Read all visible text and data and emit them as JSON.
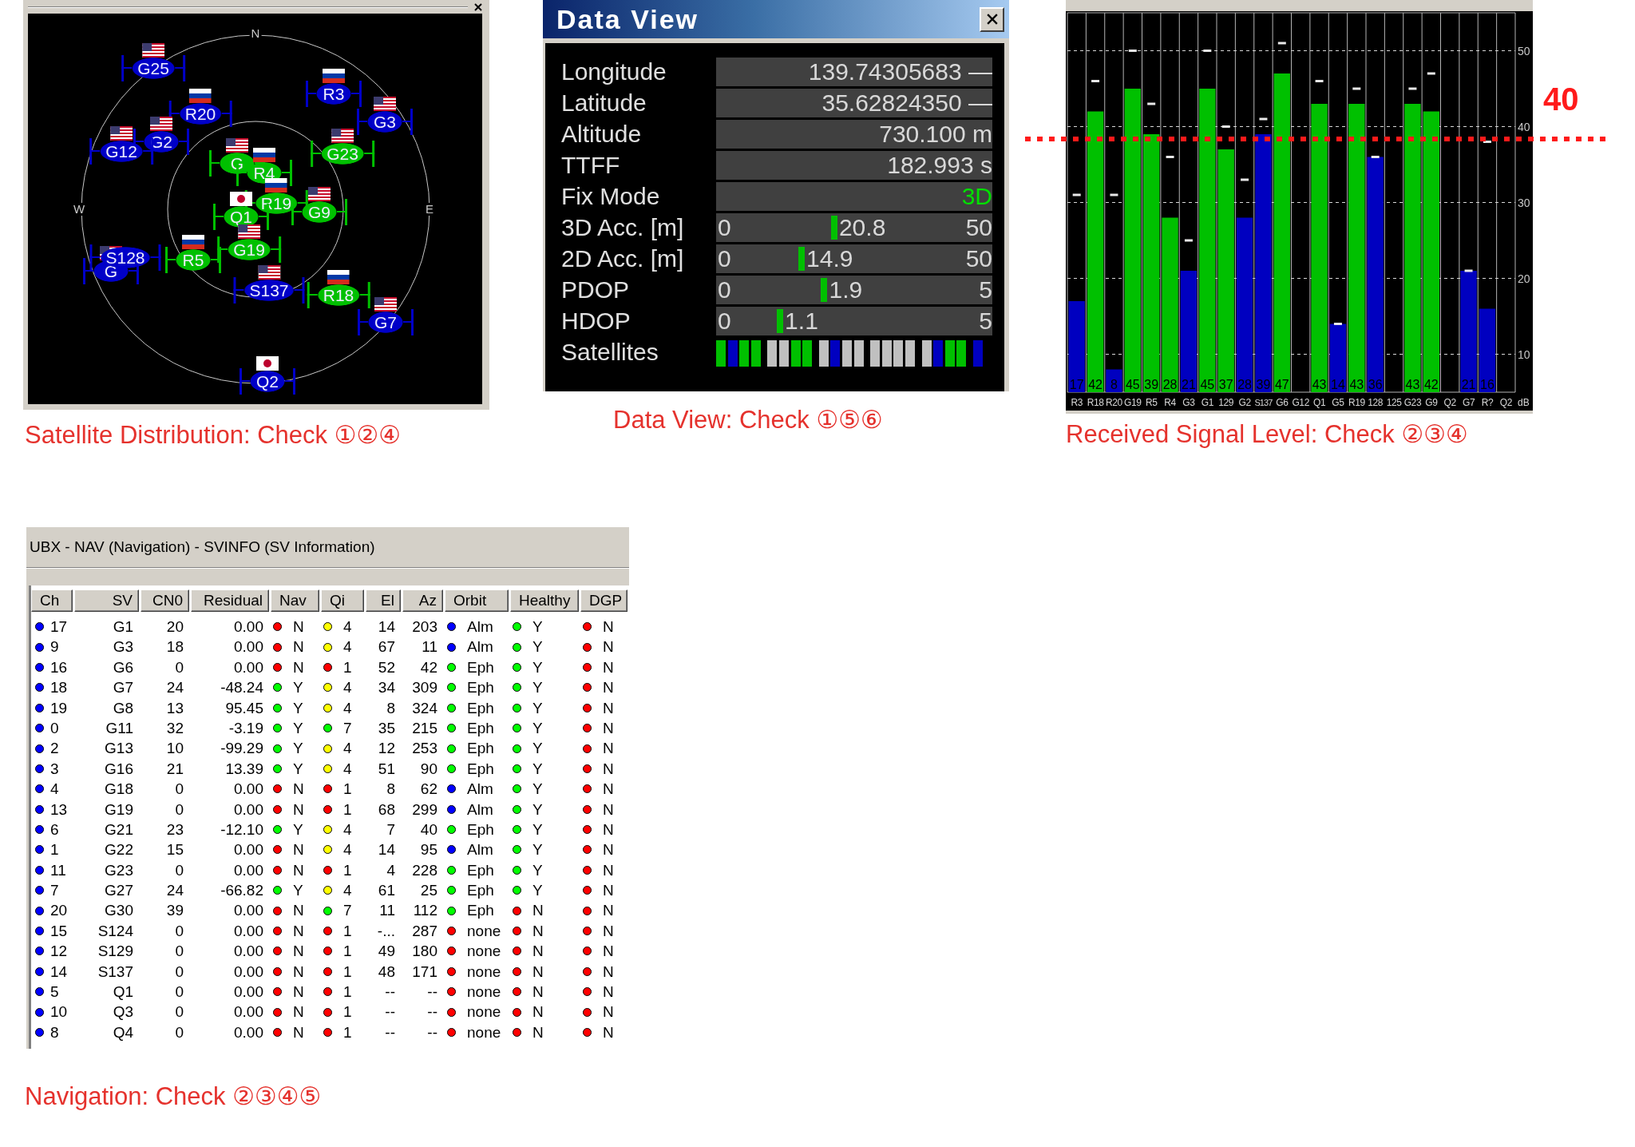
{
  "sky_plot": {
    "compass": {
      "north": "N",
      "west": "W",
      "east": "E"
    },
    "satellites": [
      {
        "label": "G25",
        "kind": "usa",
        "color": "#0000c8"
      },
      {
        "label": "R3",
        "kind": "russia",
        "color": "#0000c8"
      },
      {
        "label": "R20",
        "kind": "russia",
        "color": "#0000c8"
      },
      {
        "label": "G3",
        "kind": "usa",
        "color": "#0000c8"
      },
      {
        "label": "G2",
        "kind": "usa",
        "color": "#0000c8"
      },
      {
        "label": "G12",
        "kind": "usa",
        "color": "#0000c8"
      },
      {
        "label": "G23",
        "kind": "usa",
        "color": "#00c000"
      },
      {
        "label": "G",
        "kind": "usa",
        "color": "#00c000"
      },
      {
        "label": "R4",
        "kind": "russia",
        "color": "#00c000"
      },
      {
        "label": "R19",
        "kind": "russia",
        "color": "#00c000"
      },
      {
        "label": "G9",
        "kind": "usa",
        "color": "#00c000"
      },
      {
        "label": "Q1",
        "kind": "japan",
        "color": "#00c000"
      },
      {
        "label": "G19",
        "kind": "usa",
        "color": "#00c000"
      },
      {
        "label": "S128",
        "kind": "none",
        "color": "#0000c8"
      },
      {
        "label": "G",
        "kind": "usa",
        "color": "#0000c8"
      },
      {
        "label": "R5",
        "kind": "russia",
        "color": "#00c000"
      },
      {
        "label": "S137",
        "kind": "usa",
        "color": "#0000c8"
      },
      {
        "label": "R18",
        "kind": "russia",
        "color": "#00c000"
      },
      {
        "label": "G7",
        "kind": "usa",
        "color": "#0000c8"
      },
      {
        "label": "Q2",
        "kind": "japan",
        "color": "#0000c8"
      }
    ],
    "caption": "Satellite Distribution: Check ①②④"
  },
  "data_view": {
    "title": "Data View",
    "rows": [
      {
        "label": "Longitude",
        "kind": "text",
        "value": "139.74305683 —"
      },
      {
        "label": "Latitude",
        "kind": "text",
        "value": "35.62824350 —"
      },
      {
        "label": "Altitude",
        "kind": "text",
        "value": "730.100 m"
      },
      {
        "label": "TTFF",
        "kind": "text",
        "value": "182.993 s"
      },
      {
        "label": "Fix Mode",
        "kind": "status",
        "value": "3D"
      },
      {
        "label": "3D Acc. [m]",
        "kind": "gauge",
        "min": "0",
        "value": "20.8",
        "max": "50",
        "level": 0.416
      },
      {
        "label": "2D Acc. [m]",
        "kind": "gauge",
        "min": "0",
        "value": "14.9",
        "max": "50",
        "level": 0.298
      },
      {
        "label": "PDOP",
        "kind": "gauge",
        "min": "0",
        "value": "1.9",
        "max": "5",
        "level": 0.38
      },
      {
        "label": "HDOP",
        "kind": "gauge",
        "min": "0",
        "value": "1.1",
        "max": "5",
        "level": 0.22
      },
      {
        "label": "Satellites",
        "kind": "slots",
        "slots": [
          {
            "color": "#00c000"
          },
          {
            "color": "#0000c0"
          },
          {
            "color": "#00c000"
          },
          {
            "color": "#00c000"
          },
          {
            "color": "#c0c0c0"
          },
          {
            "color": "#c0c0c0"
          },
          {
            "color": "#00c000"
          },
          {
            "color": "#00c000"
          },
          {
            "color": "#c0c0c0"
          },
          {
            "color": "#0000c0"
          },
          {
            "color": "#c0c0c0"
          },
          {
            "color": "#c0c0c0"
          },
          {
            "color": "#c0c0c0"
          },
          {
            "color": "#c0c0c0"
          },
          {
            "color": "#c0c0c0"
          },
          {
            "color": "#c0c0c0"
          },
          {
            "color": "#c0c0c0"
          },
          {
            "color": "#0000c0"
          },
          {
            "color": "#00c000"
          },
          {
            "color": "#00c000"
          },
          {
            "color": "#0000c0"
          }
        ]
      }
    ],
    "caption": "Data View: Check ①⑤⑥"
  },
  "signal_level": {
    "chart_data": {
      "type": "bar",
      "ylabel": "dB",
      "categories": [
        "R3",
        "R18",
        "R20",
        "G19",
        "R5",
        "R4",
        "G3",
        "G1",
        "129",
        "G2",
        "S137",
        "G6",
        "G12",
        "Q1",
        "G5",
        "R19",
        "128",
        "125",
        "G23",
        "G9",
        "Q2",
        "G7",
        "R?",
        "Q2"
      ],
      "series": [
        {
          "color": "#00c000",
          "values": [
            null,
            42,
            null,
            45,
            39,
            28,
            null,
            45,
            37,
            null,
            null,
            47,
            null,
            43,
            null,
            43,
            null,
            null,
            43,
            42,
            null,
            null,
            null,
            null
          ]
        },
        {
          "color": "#0000c0",
          "values": [
            17,
            null,
            8,
            null,
            null,
            null,
            21,
            null,
            null,
            28,
            39,
            null,
            null,
            null,
            14,
            null,
            36,
            null,
            null,
            null,
            null,
            21,
            16,
            null
          ]
        },
        {
          "type": "scatter",
          "color": "#e8e8e8",
          "values": [
            31,
            46,
            31,
            50,
            43,
            36,
            25,
            50,
            40,
            33,
            41,
            51,
            null,
            46,
            14,
            45,
            36,
            null,
            45,
            47,
            null,
            21,
            38,
            null
          ]
        }
      ],
      "ylim": [
        5,
        55
      ],
      "yticks": [
        10,
        20,
        30,
        40,
        50
      ],
      "grid": true,
      "value_labels": [
        [
          null,
          "42",
          null,
          "45",
          "39",
          "28",
          null,
          "45",
          "37",
          null,
          null,
          "47",
          null,
          "43",
          null,
          "43",
          null,
          null,
          "43",
          "42",
          null,
          null,
          null,
          null
        ],
        [
          "17",
          null,
          "8",
          null,
          null,
          null,
          "21",
          null,
          null,
          "28",
          "39",
          null,
          null,
          null,
          "14",
          null,
          "36",
          null,
          null,
          null,
          null,
          "21",
          "16",
          null
        ],
        [
          null,
          null,
          null,
          null,
          null,
          null,
          null,
          null,
          null,
          null,
          null,
          null,
          null,
          null,
          null,
          null,
          null,
          null,
          null,
          null,
          null,
          null,
          null,
          null
        ]
      ]
    },
    "threshold": {
      "label": "40"
    },
    "caption": "Received Signal Level: Check ②③④"
  },
  "nav_table": {
    "title": "UBX - NAV (Navigation) - SVINFO (SV Information)",
    "columns": [
      "Ch",
      "SV",
      "CN0",
      "Residual",
      "Nav",
      "Qi",
      "El",
      "Az",
      "Orbit",
      "Healthy",
      "DGP"
    ],
    "rows": [
      {
        "cells": [
          {
            "text": "17",
            "color": "#0000ff"
          },
          {
            "text": "G1"
          },
          {
            "text": "20"
          },
          {
            "text": "0.00"
          },
          {
            "text": "N",
            "color": "#ff0000"
          },
          {
            "text": "4",
            "color": "#ffff00"
          },
          {
            "text": "14"
          },
          {
            "text": "203"
          },
          {
            "text": "Alm",
            "color": "#0000ff"
          },
          {
            "text": "Y",
            "color": "#00ff00"
          },
          {
            "text": "N",
            "color": "#ff0000"
          }
        ]
      },
      {
        "cells": [
          {
            "text": "9",
            "color": "#0000ff"
          },
          {
            "text": "G3"
          },
          {
            "text": "18"
          },
          {
            "text": "0.00"
          },
          {
            "text": "N",
            "color": "#ff0000"
          },
          {
            "text": "4",
            "color": "#ffff00"
          },
          {
            "text": "67"
          },
          {
            "text": "11"
          },
          {
            "text": "Alm",
            "color": "#0000ff"
          },
          {
            "text": "Y",
            "color": "#00ff00"
          },
          {
            "text": "N",
            "color": "#ff0000"
          }
        ]
      },
      {
        "cells": [
          {
            "text": "16",
            "color": "#0000ff"
          },
          {
            "text": "G6"
          },
          {
            "text": "0"
          },
          {
            "text": "0.00"
          },
          {
            "text": "N",
            "color": "#ff0000"
          },
          {
            "text": "1",
            "color": "#ff0000"
          },
          {
            "text": "52"
          },
          {
            "text": "42"
          },
          {
            "text": "Eph",
            "color": "#00ff00"
          },
          {
            "text": "Y",
            "color": "#00ff00"
          },
          {
            "text": "N",
            "color": "#ff0000"
          }
        ]
      },
      {
        "cells": [
          {
            "text": "18",
            "color": "#0000ff"
          },
          {
            "text": "G7"
          },
          {
            "text": "24"
          },
          {
            "text": "-48.24"
          },
          {
            "text": "Y",
            "color": "#00ff00"
          },
          {
            "text": "4",
            "color": "#ffff00"
          },
          {
            "text": "34"
          },
          {
            "text": "309"
          },
          {
            "text": "Eph",
            "color": "#00ff00"
          },
          {
            "text": "Y",
            "color": "#00ff00"
          },
          {
            "text": "N",
            "color": "#ff0000"
          }
        ]
      },
      {
        "cells": [
          {
            "text": "19",
            "color": "#0000ff"
          },
          {
            "text": "G8"
          },
          {
            "text": "13"
          },
          {
            "text": "95.45"
          },
          {
            "text": "Y",
            "color": "#00ff00"
          },
          {
            "text": "4",
            "color": "#ffff00"
          },
          {
            "text": "8"
          },
          {
            "text": "324"
          },
          {
            "text": "Eph",
            "color": "#00ff00"
          },
          {
            "text": "Y",
            "color": "#00ff00"
          },
          {
            "text": "N",
            "color": "#ff0000"
          }
        ]
      },
      {
        "cells": [
          {
            "text": "0",
            "color": "#0000ff"
          },
          {
            "text": "G11"
          },
          {
            "text": "32"
          },
          {
            "text": "-3.19"
          },
          {
            "text": "Y",
            "color": "#00ff00"
          },
          {
            "text": "7",
            "color": "#00ff00"
          },
          {
            "text": "35"
          },
          {
            "text": "215"
          },
          {
            "text": "Eph",
            "color": "#00ff00"
          },
          {
            "text": "Y",
            "color": "#00ff00"
          },
          {
            "text": "N",
            "color": "#ff0000"
          }
        ]
      },
      {
        "cells": [
          {
            "text": "2",
            "color": "#0000ff"
          },
          {
            "text": "G13"
          },
          {
            "text": "10"
          },
          {
            "text": "-99.29"
          },
          {
            "text": "Y",
            "color": "#00ff00"
          },
          {
            "text": "4",
            "color": "#ffff00"
          },
          {
            "text": "12"
          },
          {
            "text": "253"
          },
          {
            "text": "Eph",
            "color": "#00ff00"
          },
          {
            "text": "Y",
            "color": "#00ff00"
          },
          {
            "text": "N",
            "color": "#ff0000"
          }
        ]
      },
      {
        "cells": [
          {
            "text": "3",
            "color": "#0000ff"
          },
          {
            "text": "G16"
          },
          {
            "text": "21"
          },
          {
            "text": "13.39"
          },
          {
            "text": "Y",
            "color": "#00ff00"
          },
          {
            "text": "4",
            "color": "#ffff00"
          },
          {
            "text": "51"
          },
          {
            "text": "90"
          },
          {
            "text": "Eph",
            "color": "#00ff00"
          },
          {
            "text": "Y",
            "color": "#00ff00"
          },
          {
            "text": "N",
            "color": "#ff0000"
          }
        ]
      },
      {
        "cells": [
          {
            "text": "4",
            "color": "#0000ff"
          },
          {
            "text": "G18"
          },
          {
            "text": "0"
          },
          {
            "text": "0.00"
          },
          {
            "text": "N",
            "color": "#ff0000"
          },
          {
            "text": "1",
            "color": "#ff0000"
          },
          {
            "text": "8"
          },
          {
            "text": "62"
          },
          {
            "text": "Alm",
            "color": "#0000ff"
          },
          {
            "text": "Y",
            "color": "#00ff00"
          },
          {
            "text": "N",
            "color": "#ff0000"
          }
        ]
      },
      {
        "cells": [
          {
            "text": "13",
            "color": "#0000ff"
          },
          {
            "text": "G19"
          },
          {
            "text": "0"
          },
          {
            "text": "0.00"
          },
          {
            "text": "N",
            "color": "#ff0000"
          },
          {
            "text": "1",
            "color": "#ff0000"
          },
          {
            "text": "68"
          },
          {
            "text": "299"
          },
          {
            "text": "Alm",
            "color": "#0000ff"
          },
          {
            "text": "Y",
            "color": "#00ff00"
          },
          {
            "text": "N",
            "color": "#ff0000"
          }
        ]
      },
      {
        "cells": [
          {
            "text": "6",
            "color": "#0000ff"
          },
          {
            "text": "G21"
          },
          {
            "text": "23"
          },
          {
            "text": "-12.10"
          },
          {
            "text": "Y",
            "color": "#00ff00"
          },
          {
            "text": "4",
            "color": "#ffff00"
          },
          {
            "text": "7"
          },
          {
            "text": "40"
          },
          {
            "text": "Eph",
            "color": "#00ff00"
          },
          {
            "text": "Y",
            "color": "#00ff00"
          },
          {
            "text": "N",
            "color": "#ff0000"
          }
        ]
      },
      {
        "cells": [
          {
            "text": "1",
            "color": "#0000ff"
          },
          {
            "text": "G22"
          },
          {
            "text": "15"
          },
          {
            "text": "0.00"
          },
          {
            "text": "N",
            "color": "#ff0000"
          },
          {
            "text": "4",
            "color": "#ffff00"
          },
          {
            "text": "14"
          },
          {
            "text": "95"
          },
          {
            "text": "Alm",
            "color": "#0000ff"
          },
          {
            "text": "Y",
            "color": "#00ff00"
          },
          {
            "text": "N",
            "color": "#ff0000"
          }
        ]
      },
      {
        "cells": [
          {
            "text": "11",
            "color": "#0000ff"
          },
          {
            "text": "G23"
          },
          {
            "text": "0"
          },
          {
            "text": "0.00"
          },
          {
            "text": "N",
            "color": "#ff0000"
          },
          {
            "text": "1",
            "color": "#ff0000"
          },
          {
            "text": "4"
          },
          {
            "text": "228"
          },
          {
            "text": "Eph",
            "color": "#00ff00"
          },
          {
            "text": "Y",
            "color": "#00ff00"
          },
          {
            "text": "N",
            "color": "#ff0000"
          }
        ]
      },
      {
        "cells": [
          {
            "text": "7",
            "color": "#0000ff"
          },
          {
            "text": "G27"
          },
          {
            "text": "24"
          },
          {
            "text": "-66.82"
          },
          {
            "text": "Y",
            "color": "#00ff00"
          },
          {
            "text": "4",
            "color": "#ffff00"
          },
          {
            "text": "61"
          },
          {
            "text": "25"
          },
          {
            "text": "Eph",
            "color": "#00ff00"
          },
          {
            "text": "Y",
            "color": "#00ff00"
          },
          {
            "text": "N",
            "color": "#ff0000"
          }
        ]
      },
      {
        "cells": [
          {
            "text": "20",
            "color": "#0000ff"
          },
          {
            "text": "G30"
          },
          {
            "text": "39"
          },
          {
            "text": "0.00"
          },
          {
            "text": "N",
            "color": "#ff0000"
          },
          {
            "text": "7",
            "color": "#00ff00"
          },
          {
            "text": "11"
          },
          {
            "text": "112"
          },
          {
            "text": "Eph",
            "color": "#00ff00"
          },
          {
            "text": "N",
            "color": "#ff0000"
          },
          {
            "text": "N",
            "color": "#ff0000"
          }
        ]
      },
      {
        "cells": [
          {
            "text": "15",
            "color": "#0000ff"
          },
          {
            "text": "S124"
          },
          {
            "text": "0"
          },
          {
            "text": "0.00"
          },
          {
            "text": "N",
            "color": "#ff0000"
          },
          {
            "text": "1",
            "color": "#ff0000"
          },
          {
            "text": "-..."
          },
          {
            "text": "287"
          },
          {
            "text": "none",
            "color": "#ff0000"
          },
          {
            "text": "N",
            "color": "#ff0000"
          },
          {
            "text": "N",
            "color": "#ff0000"
          }
        ]
      },
      {
        "cells": [
          {
            "text": "12",
            "color": "#0000ff"
          },
          {
            "text": "S129"
          },
          {
            "text": "0"
          },
          {
            "text": "0.00"
          },
          {
            "text": "N",
            "color": "#ff0000"
          },
          {
            "text": "1",
            "color": "#ff0000"
          },
          {
            "text": "49"
          },
          {
            "text": "180"
          },
          {
            "text": "none",
            "color": "#ff0000"
          },
          {
            "text": "N",
            "color": "#ff0000"
          },
          {
            "text": "N",
            "color": "#ff0000"
          }
        ]
      },
      {
        "cells": [
          {
            "text": "14",
            "color": "#0000ff"
          },
          {
            "text": "S137"
          },
          {
            "text": "0"
          },
          {
            "text": "0.00"
          },
          {
            "text": "N",
            "color": "#ff0000"
          },
          {
            "text": "1",
            "color": "#ff0000"
          },
          {
            "text": "48"
          },
          {
            "text": "171"
          },
          {
            "text": "none",
            "color": "#ff0000"
          },
          {
            "text": "N",
            "color": "#ff0000"
          },
          {
            "text": "N",
            "color": "#ff0000"
          }
        ]
      },
      {
        "cells": [
          {
            "text": "5",
            "color": "#0000ff"
          },
          {
            "text": "Q1"
          },
          {
            "text": "0"
          },
          {
            "text": "0.00"
          },
          {
            "text": "N",
            "color": "#ff0000"
          },
          {
            "text": "1",
            "color": "#ff0000"
          },
          {
            "text": "--"
          },
          {
            "text": "--"
          },
          {
            "text": "none",
            "color": "#ff0000"
          },
          {
            "text": "N",
            "color": "#ff0000"
          },
          {
            "text": "N",
            "color": "#ff0000"
          }
        ]
      },
      {
        "cells": [
          {
            "text": "10",
            "color": "#0000ff"
          },
          {
            "text": "Q3"
          },
          {
            "text": "0"
          },
          {
            "text": "0.00"
          },
          {
            "text": "N",
            "color": "#ff0000"
          },
          {
            "text": "1",
            "color": "#ff0000"
          },
          {
            "text": "--"
          },
          {
            "text": "--"
          },
          {
            "text": "none",
            "color": "#ff0000"
          },
          {
            "text": "N",
            "color": "#ff0000"
          },
          {
            "text": "N",
            "color": "#ff0000"
          }
        ]
      },
      {
        "cells": [
          {
            "text": "8",
            "color": "#0000ff"
          },
          {
            "text": "Q4"
          },
          {
            "text": "0"
          },
          {
            "text": "0.00"
          },
          {
            "text": "N",
            "color": "#ff0000"
          },
          {
            "text": "1",
            "color": "#ff0000"
          },
          {
            "text": "--"
          },
          {
            "text": "--"
          },
          {
            "text": "none",
            "color": "#ff0000"
          },
          {
            "text": "N",
            "color": "#ff0000"
          },
          {
            "text": "N",
            "color": "#ff0000"
          }
        ]
      }
    ],
    "caption": "Navigation: Check ②③④⑤"
  }
}
